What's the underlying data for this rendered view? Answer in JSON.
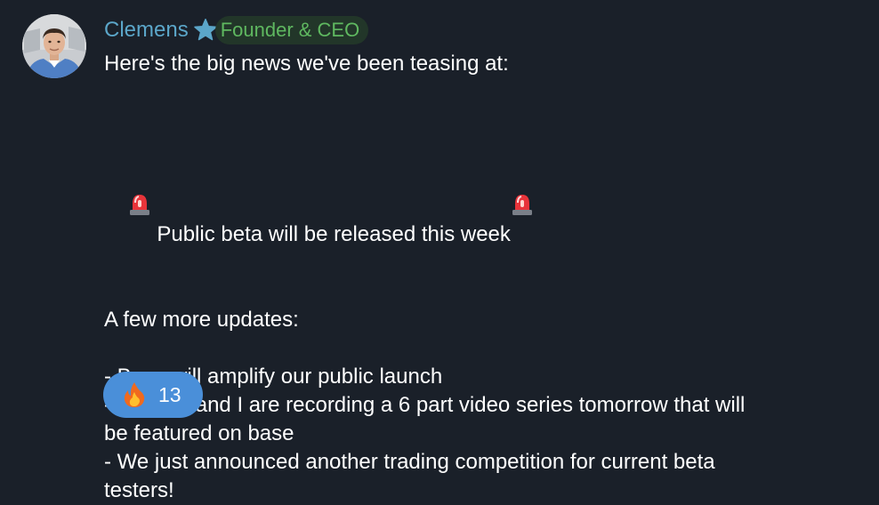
{
  "sender": {
    "name": "Clemens",
    "badge_icon": "star-icon",
    "role": "Founder & CEO",
    "name_color": "#5ba6c9",
    "role_color": "#5fb860"
  },
  "message": {
    "intro": "Here's the big news we've been teasing at:",
    "highlight_icon": "siren-icon",
    "highlight": " Public beta will be released this week",
    "subheading": "A few more updates:",
    "update_1": "- Base will amplify our public launch",
    "update_2_line_1": "- Kenzan and I are recording a 6 part video series tomorrow that will",
    "update_2_line_2": "be featured on base",
    "update_3_line_1": "- We just announced another trading competition for current beta",
    "update_3_line_2": "testers!"
  },
  "reaction": {
    "icon": "fire-icon",
    "count": "13",
    "color": "#4a8fd9"
  }
}
